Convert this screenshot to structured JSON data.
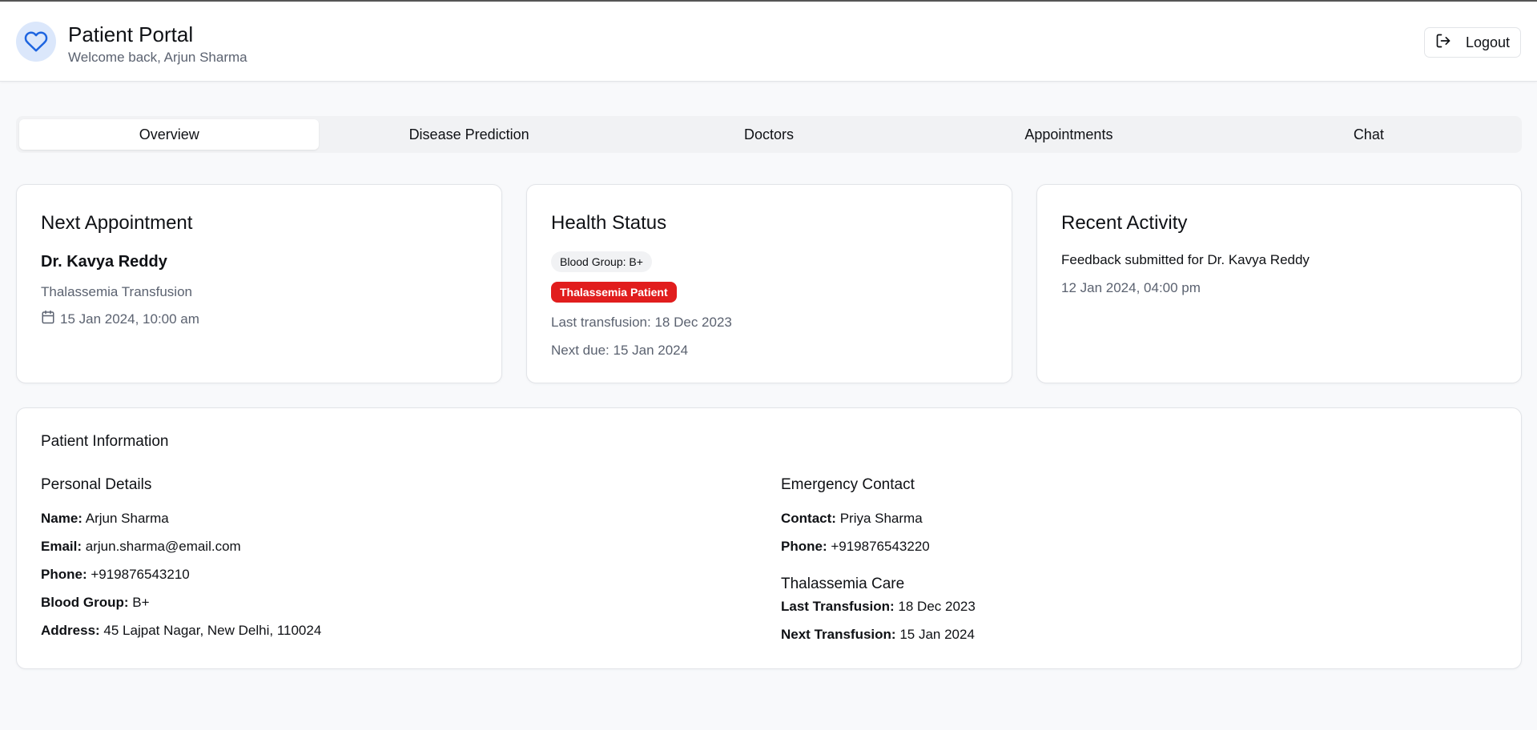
{
  "header": {
    "title": "Patient Portal",
    "subtitle": "Welcome back, Arjun Sharma",
    "logout_label": "Logout",
    "icon": "heart-icon",
    "accent": "#1d64e0"
  },
  "tabs": [
    {
      "label": "Overview",
      "active": true
    },
    {
      "label": "Disease Prediction",
      "active": false
    },
    {
      "label": "Doctors",
      "active": false
    },
    {
      "label": "Appointments",
      "active": false
    },
    {
      "label": "Chat",
      "active": false
    }
  ],
  "next_appointment": {
    "title": "Next Appointment",
    "doctor": "Dr. Kavya Reddy",
    "type": "Thalassemia Transfusion",
    "datetime": "15 Jan 2024, 10:00 am",
    "icon": "calendar-icon"
  },
  "health_status": {
    "title": "Health Status",
    "blood_group_badge": "Blood Group: B+",
    "condition_badge": "Thalassemia Patient",
    "condition_color": "#e11d1d",
    "last_transfusion": "Last transfusion: 18 Dec 2023",
    "next_due": "Next due: 15 Jan 2024"
  },
  "recent_activity": {
    "title": "Recent Activity",
    "item": "Feedback submitted for Dr. Kavya Reddy",
    "timestamp": "12 Jan 2024, 04:00 pm"
  },
  "patient_info": {
    "title": "Patient Information",
    "personal": {
      "heading": "Personal Details",
      "name_label": "Name:",
      "name": "Arjun Sharma",
      "email_label": "Email:",
      "email": "arjun.sharma@email.com",
      "phone_label": "Phone:",
      "phone": "+919876543210",
      "blood_label": "Blood Group:",
      "blood": "B+",
      "address_label": "Address:",
      "address": "45 Lajpat Nagar, New Delhi, 110024"
    },
    "emergency": {
      "heading": "Emergency Contact",
      "contact_label": "Contact:",
      "contact": "Priya Sharma",
      "phone_label": "Phone:",
      "phone": "+919876543220"
    },
    "care": {
      "heading": "Thalassemia Care",
      "last_label": "Last Transfusion:",
      "last": "18 Dec 2023",
      "next_label": "Next Transfusion:",
      "next": "15 Jan 2024"
    }
  }
}
